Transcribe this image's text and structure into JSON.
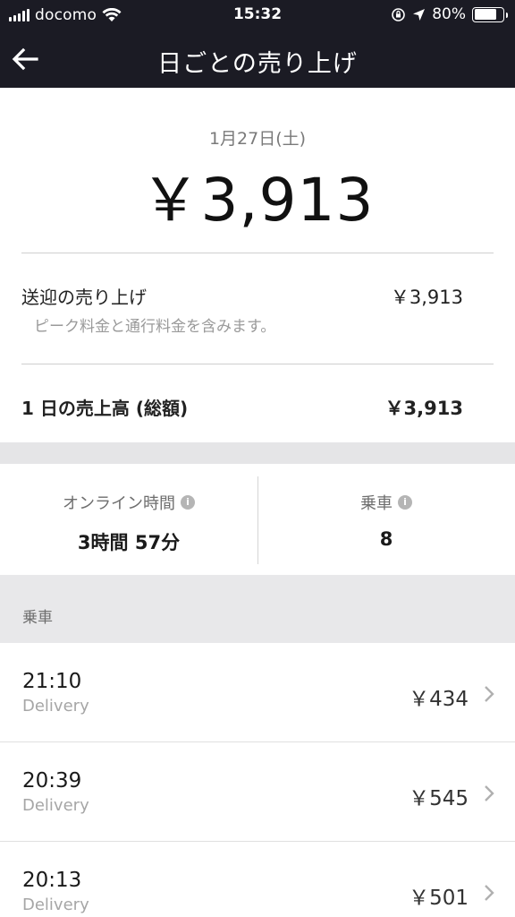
{
  "status_bar": {
    "carrier": "docomo",
    "time": "15:32",
    "battery": "80%",
    "battery_level": 0.8,
    "icons": [
      "signal-icon",
      "wifi-icon",
      "orientation-lock-icon",
      "location-arrow-icon",
      "battery-icon"
    ]
  },
  "nav": {
    "title": "日ごとの売り上げ",
    "back_icon": "arrow-left-icon"
  },
  "summary": {
    "date": "1月27日(土)",
    "total": "￥3,913"
  },
  "fare_breakdown": {
    "label": "送迎の売り上げ",
    "value": "￥3,913",
    "note": "ピーク料金と通行料金を含みます。"
  },
  "daily_total": {
    "label": "1 日の売上高 (総額)",
    "value": "￥3,913"
  },
  "stats": {
    "online": {
      "label": "オンライン時間",
      "value": "3時間 57分"
    },
    "trips": {
      "label": "乗車",
      "value": "8"
    },
    "info_icon": "info-icon"
  },
  "rides_section": {
    "header": "乗車",
    "items": [
      {
        "time": "21:10",
        "type": "Delivery",
        "fare": "￥434"
      },
      {
        "time": "20:39",
        "type": "Delivery",
        "fare": "￥545"
      },
      {
        "time": "20:13",
        "type": "Delivery",
        "fare": "￥501"
      }
    ]
  },
  "colors": {
    "header_bg": "#1b1b24",
    "section_bg": "#e8e8ea",
    "muted_text": "#9a9a9a"
  }
}
